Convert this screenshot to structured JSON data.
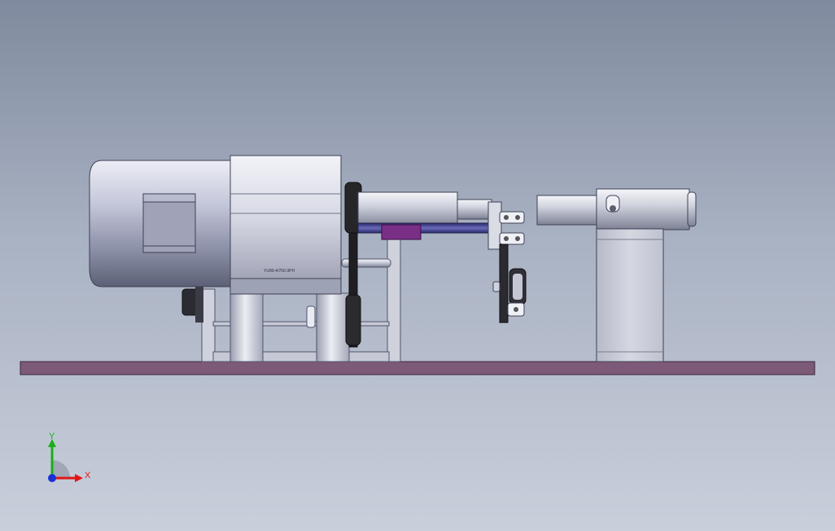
{
  "view": {
    "triad": {
      "x_label": "X",
      "y_label": "Y",
      "x_color": "#e01818",
      "y_color": "#18b018",
      "z_color": "#1830d8"
    }
  },
  "model": {
    "motor_nameplate": "YU90-4/750-3PH",
    "colors": {
      "base_plate": "#7d5a78",
      "metal_light": "#e6e8f0",
      "metal_dark": "#6f7486",
      "belt": "#1c1c1c",
      "accent_purple": "#7a2f86",
      "shaft_blue": "#3a3a8a"
    }
  }
}
